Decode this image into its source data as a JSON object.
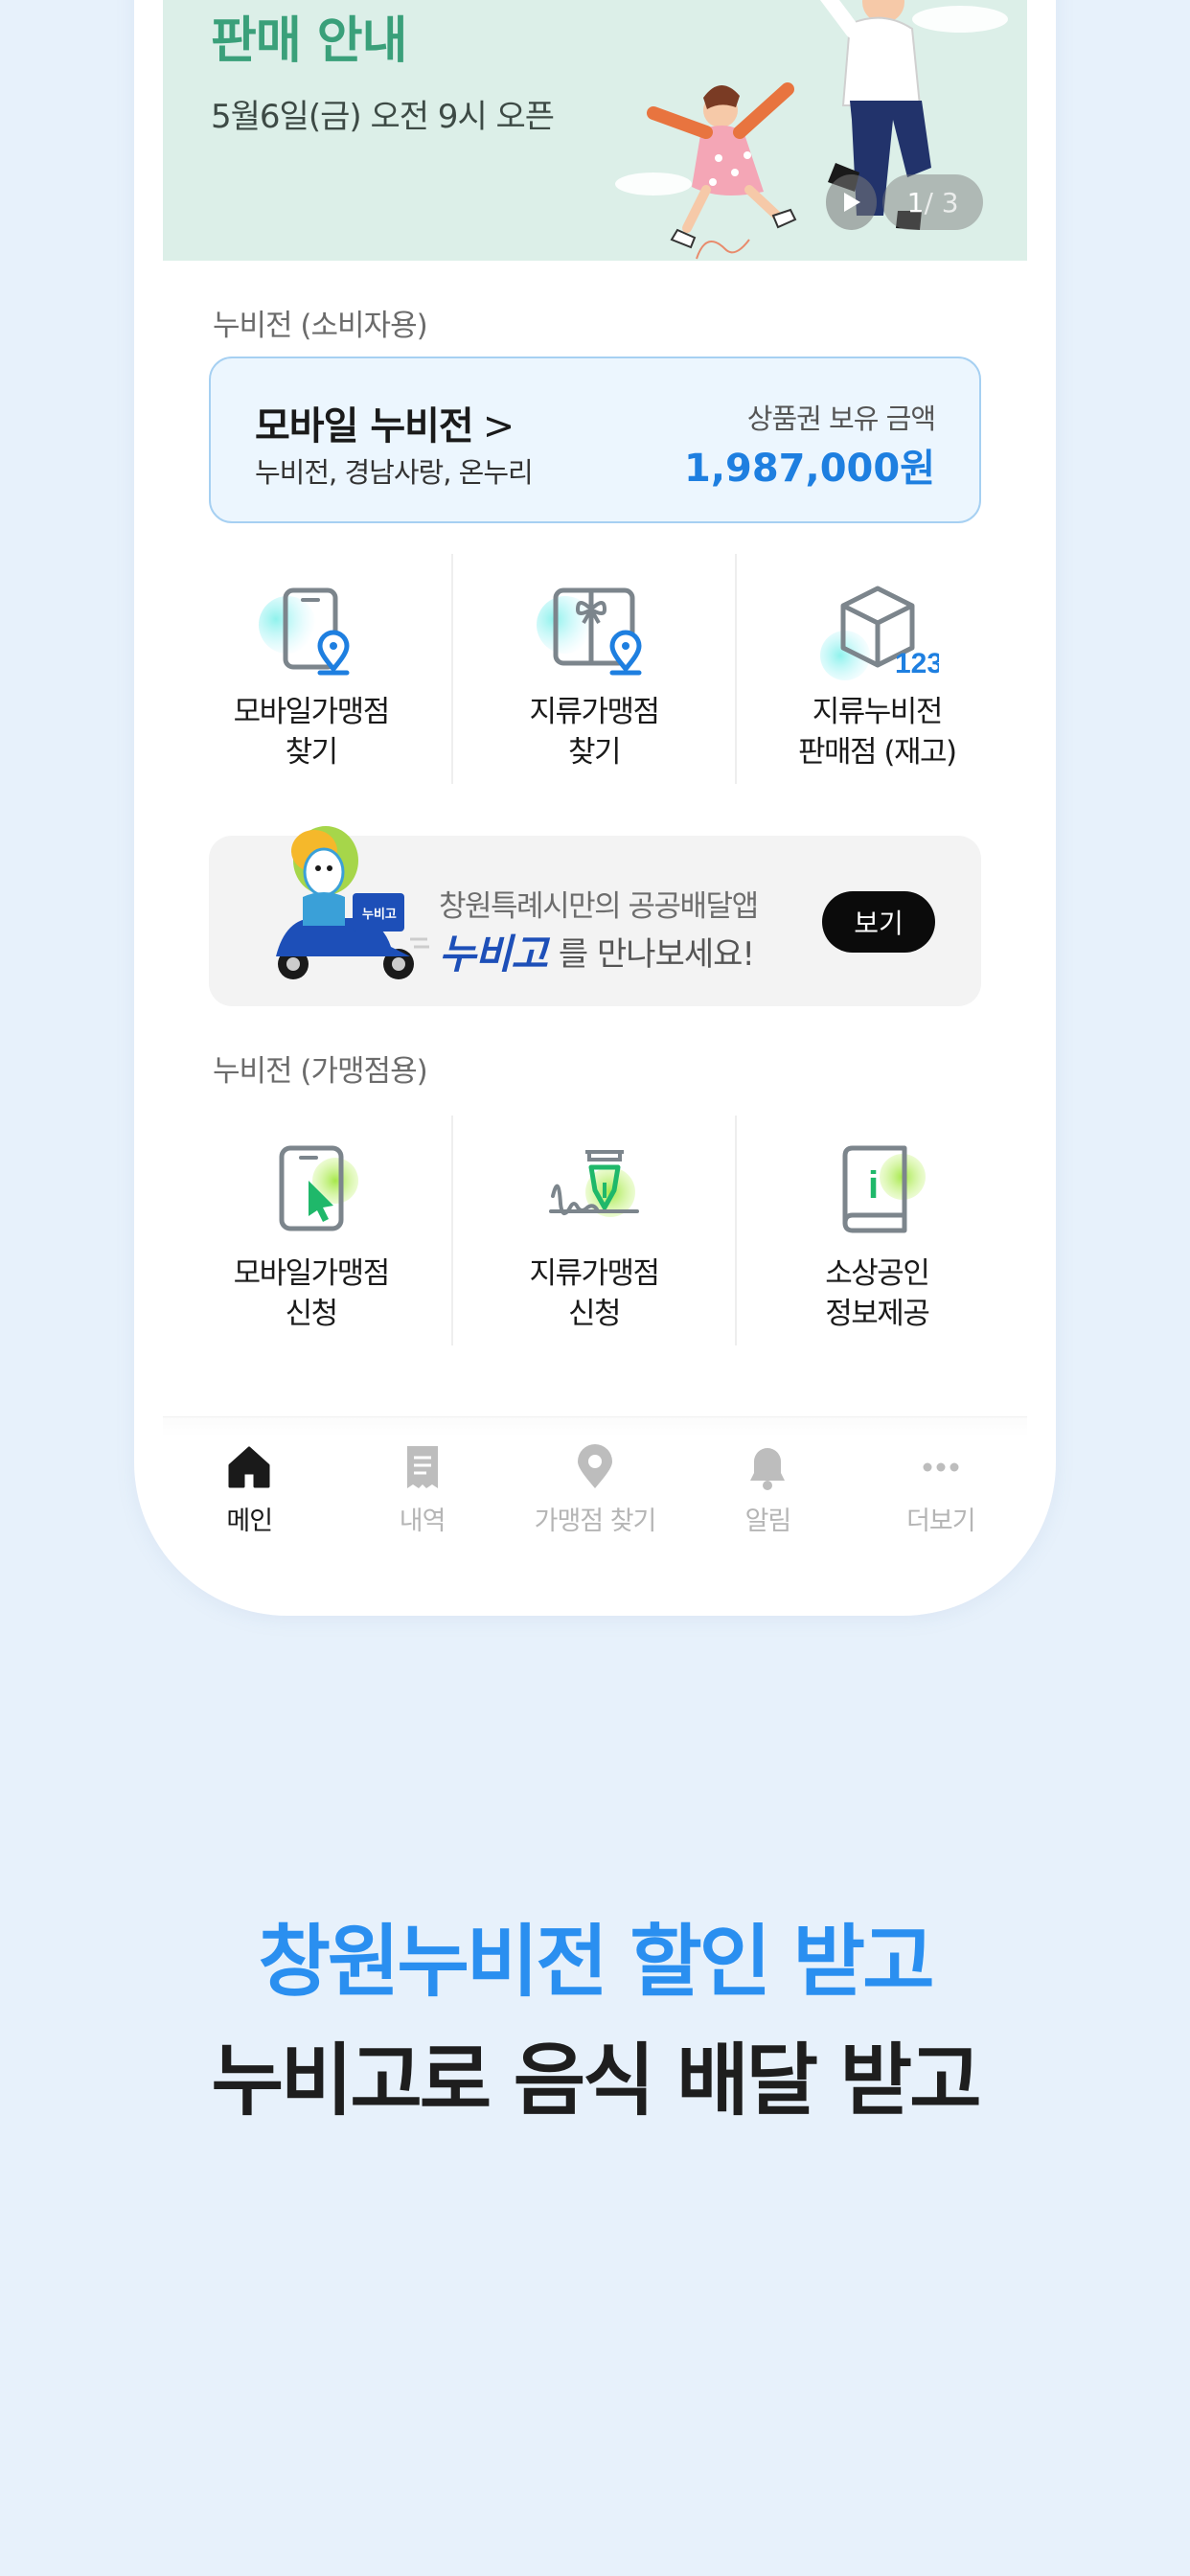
{
  "banner": {
    "title": "판매 안내",
    "subtitle": "5월6일(금) 오전 9시 오픈",
    "page_current": "1",
    "page_total": " / 3",
    "play_icon": "play-icon"
  },
  "consumer_section": {
    "label": "누비전 (소비자용)",
    "card": {
      "title": "모바일 누비전",
      "chevron": ">",
      "subtitle": "누비전, 경남사랑, 온누리",
      "balance_label": "상품권 보유 금액",
      "balance_amount": "1,987,000원"
    },
    "menu": [
      {
        "label": "모바일가맹점\n찾기",
        "icon": "phone-location-icon"
      },
      {
        "label": "지류가맹점\n찾기",
        "icon": "gift-location-icon"
      },
      {
        "label": "지류누비전\n판매점 (재고)",
        "icon": "box-stock-icon",
        "icon_text": "123"
      }
    ]
  },
  "promo": {
    "line1": "창원특례시만의 공공배달앱",
    "brand": "누비고",
    "line2_suffix": "를 만나보세요!",
    "button": "보기",
    "scooter_badge": "누비고"
  },
  "merchant_section": {
    "label": "누비전 (가맹점용)",
    "menu": [
      {
        "label": "모바일가맹점\n신청",
        "icon": "phone-cursor-icon"
      },
      {
        "label": "지류가맹점\n신청",
        "icon": "pen-sign-icon"
      },
      {
        "label": "소상공인\n정보제공",
        "icon": "info-book-icon",
        "icon_text": "i"
      }
    ]
  },
  "tabbar": [
    {
      "label": "메인",
      "icon": "home-icon",
      "active": true
    },
    {
      "label": "내역",
      "icon": "receipt-icon",
      "active": false
    },
    {
      "label": "가맹점 찾기",
      "icon": "map-pin-icon",
      "active": false
    },
    {
      "label": "알림",
      "icon": "bell-icon",
      "active": false
    },
    {
      "label": "더보기",
      "icon": "more-dots-icon",
      "active": false
    }
  ],
  "headline": {
    "line1": "창원누비전 할인 받고",
    "line2": "누비고로 음식 배달 받고"
  },
  "colors": {
    "accent_blue": "#1e7fe0",
    "banner_green": "#3aa07a",
    "background": "#e7f1fb"
  }
}
